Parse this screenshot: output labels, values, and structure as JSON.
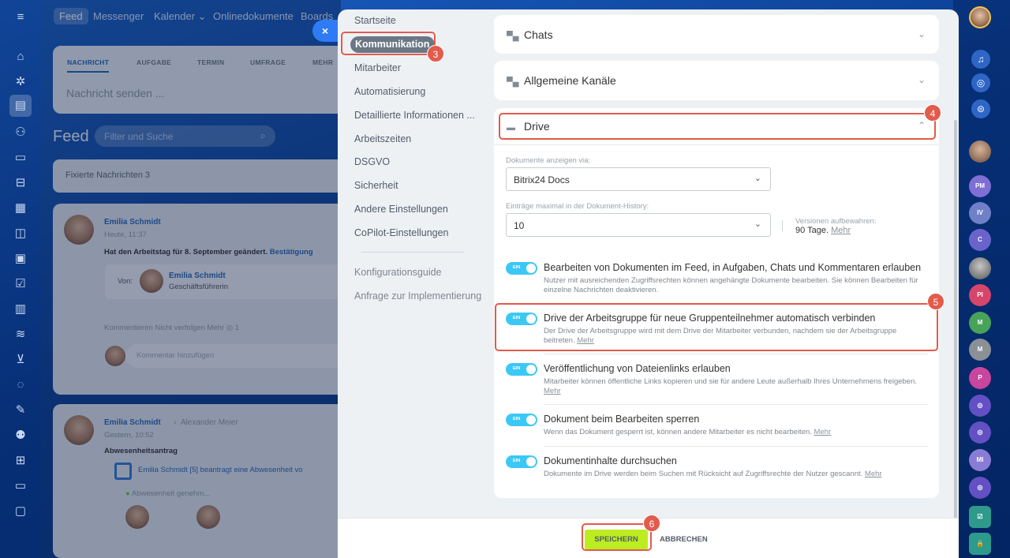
{
  "topnav": {
    "items": [
      "Feed",
      "Messenger",
      "Kalender",
      "Onlinedokumente",
      "Boards"
    ]
  },
  "compose": {
    "tabs": [
      "NACHRICHT",
      "AUFGABE",
      "TERMIN",
      "UMFRAGE",
      "MEHR"
    ],
    "placeholder": "Nachricht senden ..."
  },
  "feed": {
    "title": "Feed",
    "filter_placeholder": "Filter und Suche",
    "pinned": "Fixierte Nachrichten 3",
    "post1": {
      "author": "Emilia Schmidt",
      "time": "Heute, 11:37",
      "text": "Hat den Arbeitstag für 8. September geändert.",
      "link": "Bestätigung",
      "from_label": "Von:",
      "from_name": "Emilia Schmidt",
      "from_role": "Geschäftsführerin",
      "actions": "Kommentieren   Nicht verfolgen   Mehr   ◎ 1",
      "comment_placeholder": "Kommentar hinzufügen"
    },
    "post2": {
      "author": "Emilia Schmidt",
      "recipient": "Alexander Meier",
      "time": "Gestern, 10:52",
      "title": "Abwesenheitsantrag",
      "text": "Emilia Schmidt [5] beantragt eine Abwesenheit vo",
      "status": "Abwesenheit genehm..."
    }
  },
  "right_rail": {
    "avatars": [
      "PM",
      "IV",
      "C",
      "PI",
      "M",
      "M",
      "P",
      "MI"
    ]
  },
  "settings_nav": {
    "items": [
      "Startseite",
      "Kommunikation",
      "Mitarbeiter",
      "Automatisierung",
      "Detaillierte Informationen ...",
      "Arbeitszeiten",
      "DSGVO",
      "Sicherheit",
      "Andere Einstellungen",
      "CoPilot-Einstellungen"
    ],
    "extra": [
      "Konfigurationsguide",
      "Anfrage zur Implementierung"
    ]
  },
  "sections": {
    "chats": "Chats",
    "channels": "Allgemeine Kanäle",
    "drive": "Drive"
  },
  "drive": {
    "docs_label": "Dokumente anzeigen via:",
    "docs_value": "Bitrix24 Docs",
    "history_label": "Einträge maximal in der Dokument-History:",
    "history_value": "10",
    "versions_label": "Versionen aufbewahren:",
    "versions_value": "90 Tage.",
    "versions_link": "Mehr",
    "toggle_label": "EIN",
    "options": [
      {
        "title": "Bearbeiten von Dokumenten im Feed, in Aufgaben, Chats und Kommentaren erlauben",
        "desc": "Nutzer mit ausreichenden Zugriffsrechten können angehängte Dokumente bearbeiten. Sie können Bearbeiten für einzelne Nachrichten deaktivieren.",
        "link": ""
      },
      {
        "title": "Drive der Arbeitsgruppe für neue Gruppenteilnehmer automatisch verbinden",
        "desc": "Der Drive der Arbeitsgruppe wird mit dem Drive der Mitarbeiter verbunden, nachdem sie der Arbeitsgruppe beitreten.",
        "link": "Mehr"
      },
      {
        "title": "Veröffentlichung von Dateienlinks erlauben",
        "desc": "Mitarbeiter können öffentliche Links kopieren und sie für andere Leute außerhalb Ihres Unternehmens freigeben.",
        "link": "Mehr"
      },
      {
        "title": "Dokument beim Bearbeiten sperren",
        "desc": "Wenn das Dokument gesperrt ist, können andere Mitarbeiter es nicht bearbeiten.",
        "link": "Mehr"
      },
      {
        "title": "Dokumentinhalte durchsuchen",
        "desc": "Dokumente im Drive werden beim Suchen mit Rücksicht auf Zugriffsrechte der Nutzer gescannt.",
        "link": "Mehr"
      }
    ]
  },
  "footer": {
    "save": "SPEICHERN",
    "cancel": "ABBRECHEN"
  },
  "close_glyph": "×",
  "badges": [
    "3",
    "4",
    "5",
    "6"
  ],
  "colors": {
    "accent_toggle": "#3bc8f5",
    "save_button": "#bbed21",
    "highlight": "#e25b4b"
  }
}
